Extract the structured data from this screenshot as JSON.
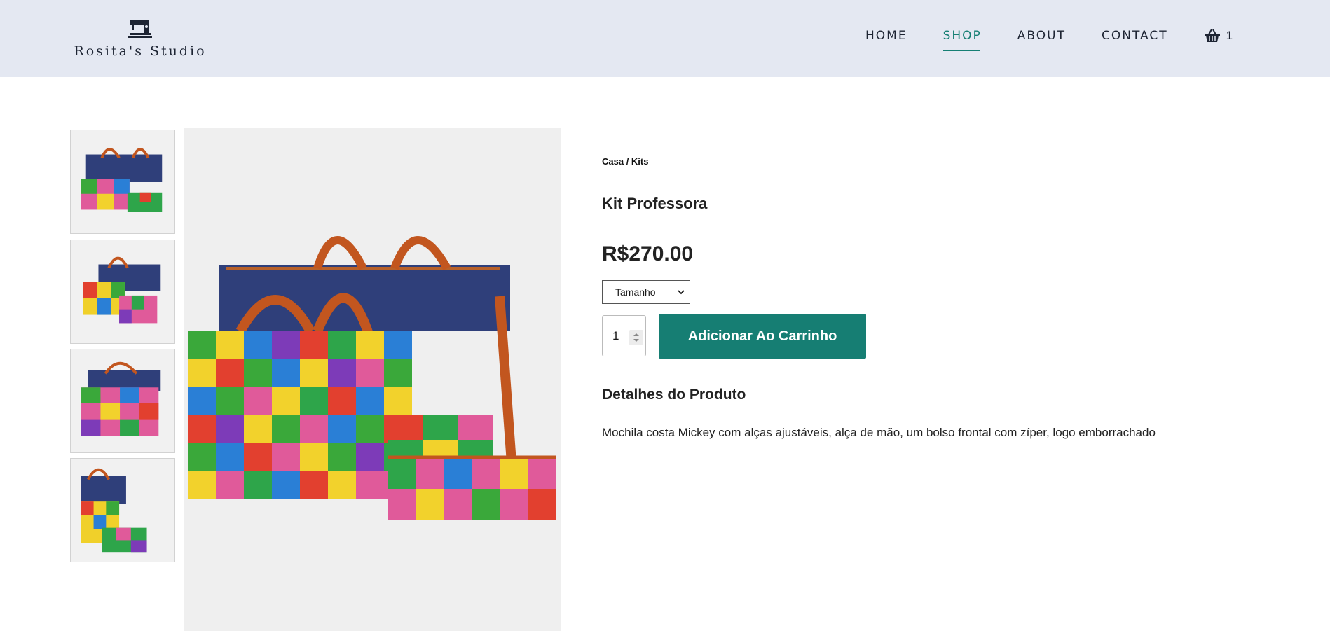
{
  "brand": {
    "name": "Rosita's Studio",
    "icon": "sewing-machine-icon"
  },
  "nav": {
    "items": [
      {
        "label": "HOME",
        "active": false
      },
      {
        "label": "SHOP",
        "active": true
      },
      {
        "label": "ABOUT",
        "active": false
      },
      {
        "label": "CONTACT",
        "active": false
      }
    ],
    "cart": {
      "icon": "basket-icon",
      "count": "1"
    }
  },
  "gallery": {
    "thumbnails": [
      {
        "alt": "Kit Professora view 1"
      },
      {
        "alt": "Kit Professora view 2"
      },
      {
        "alt": "Kit Professora view 3"
      },
      {
        "alt": "Kit Professora view 4"
      }
    ],
    "selected_index": 0
  },
  "product": {
    "breadcrumb": {
      "home": "Casa",
      "separator": " / ",
      "category": "Kits"
    },
    "title": "Kit Professora",
    "price": "R$270.00",
    "size_select": {
      "selected": "Tamanho"
    },
    "quantity": "1",
    "add_to_cart_label": "Adicionar Ao Carrinho",
    "details_title": "Detalhes do Produto",
    "details_text": "Mochila costa Mickey com alças ajustáveis, alça de mão, um bolso frontal com zíper, logo emborrachado"
  },
  "colors": {
    "header_bg": "#e4e8f2",
    "accent": "#157f74",
    "button_bg": "#167e73"
  }
}
